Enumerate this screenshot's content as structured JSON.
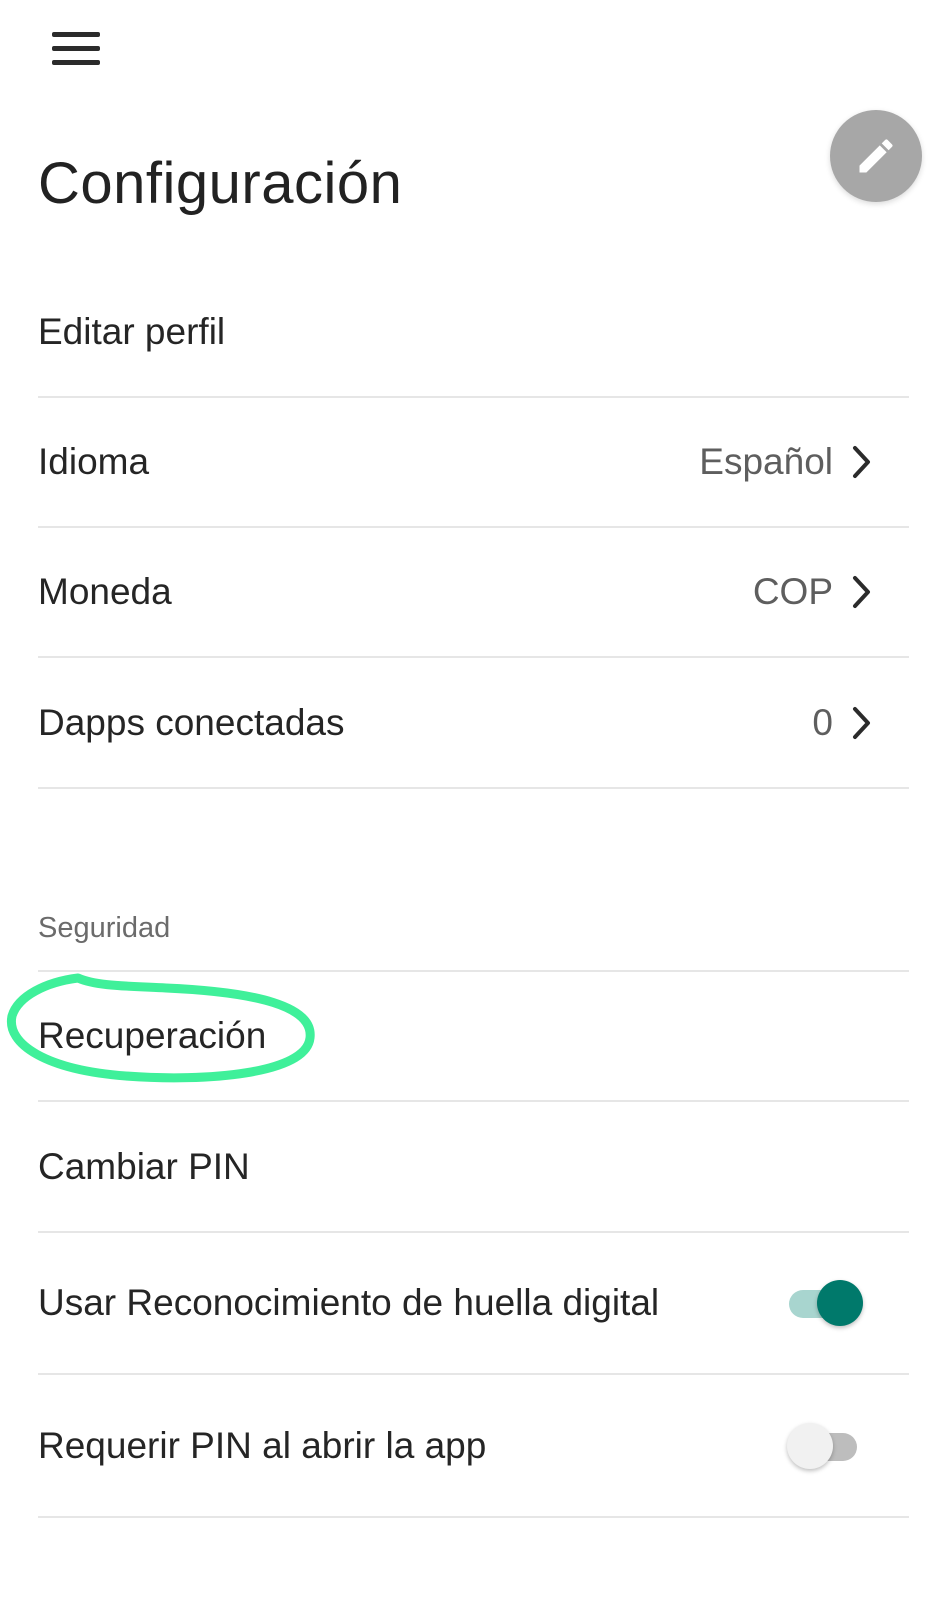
{
  "header": {
    "title": "Configuración",
    "menu_icon": "hamburger-menu-icon",
    "edit_icon": "pencil-icon"
  },
  "account_items": [
    {
      "label": "Editar perfil"
    },
    {
      "label": "Idioma",
      "value": "Español"
    },
    {
      "label": "Moneda",
      "value": "COP"
    },
    {
      "label": "Dapps conectadas",
      "value": "0"
    }
  ],
  "security": {
    "header": "Seguridad",
    "items": [
      {
        "label": "Recuperación"
      },
      {
        "label": "Cambiar PIN"
      },
      {
        "label": "Usar Reconocimiento de huella digital",
        "toggle": true
      },
      {
        "label": "Requerir PIN al abrir la app",
        "toggle": false
      }
    ]
  },
  "colors": {
    "toggle_on_thumb": "#00796b",
    "toggle_on_track": "#a8d5cf",
    "toggle_off_thumb": "#f1f1f1",
    "toggle_off_track": "#bdbdbd",
    "highlight_annotation": "#3ff09a",
    "fab_background": "#a7a7a7"
  }
}
